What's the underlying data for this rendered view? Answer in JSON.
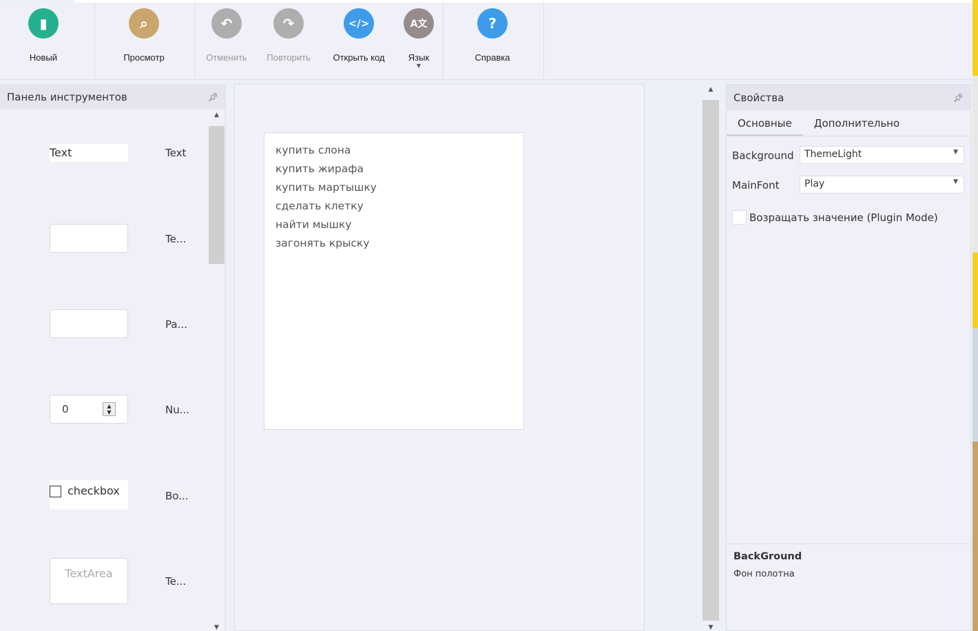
{
  "toolbar": {
    "items": [
      {
        "label": "Новый",
        "icon": "new-file-icon",
        "color": "#25b08f",
        "enabled": true
      },
      {
        "label": "Просмотр",
        "icon": "preview-icon",
        "color": "#c9a66b",
        "enabled": true
      },
      {
        "label": "Отменить",
        "icon": "undo-icon",
        "color": "#aeaeae",
        "enabled": false
      },
      {
        "label": "Повторить",
        "icon": "redo-icon",
        "color": "#aeaeae",
        "enabled": false
      },
      {
        "label": "Открыть код",
        "icon": "code-icon",
        "color": "#3d9be9",
        "enabled": true
      },
      {
        "label": "Язык",
        "icon": "language-icon",
        "color": "#968c8c",
        "enabled": true
      },
      {
        "label": "Справка",
        "icon": "help-icon",
        "color": "#3d9be9",
        "enabled": true
      }
    ]
  },
  "toolbox": {
    "title": "Панель инструментов",
    "items": [
      {
        "preview": "Text",
        "name": "Text"
      },
      {
        "preview": "",
        "name": "Te..."
      },
      {
        "preview": "",
        "name": "Pa..."
      },
      {
        "preview": "0",
        "name": "Nu..."
      },
      {
        "preview": "checkbox",
        "name": "Bo..."
      },
      {
        "preview": "TextArea",
        "name": "Te..."
      }
    ]
  },
  "canvas": {
    "lines": [
      "купить слона",
      "купить жирафа",
      "купить мартышку",
      "сделать клетку",
      "найти мышку",
      "загонять крыску"
    ]
  },
  "properties": {
    "title": "Свойства",
    "tabs": [
      "Основные",
      "Дополнительно"
    ],
    "background_label": "Background",
    "background_value": "ThemeLight",
    "mainfont_label": "MainFont",
    "mainfont_value": "Play",
    "plugin_mode_label": "Возращать значение (Plugin Mode)",
    "plugin_mode_checked": false,
    "desc_title": "BackGround",
    "desc_text": "Фон полотна"
  }
}
